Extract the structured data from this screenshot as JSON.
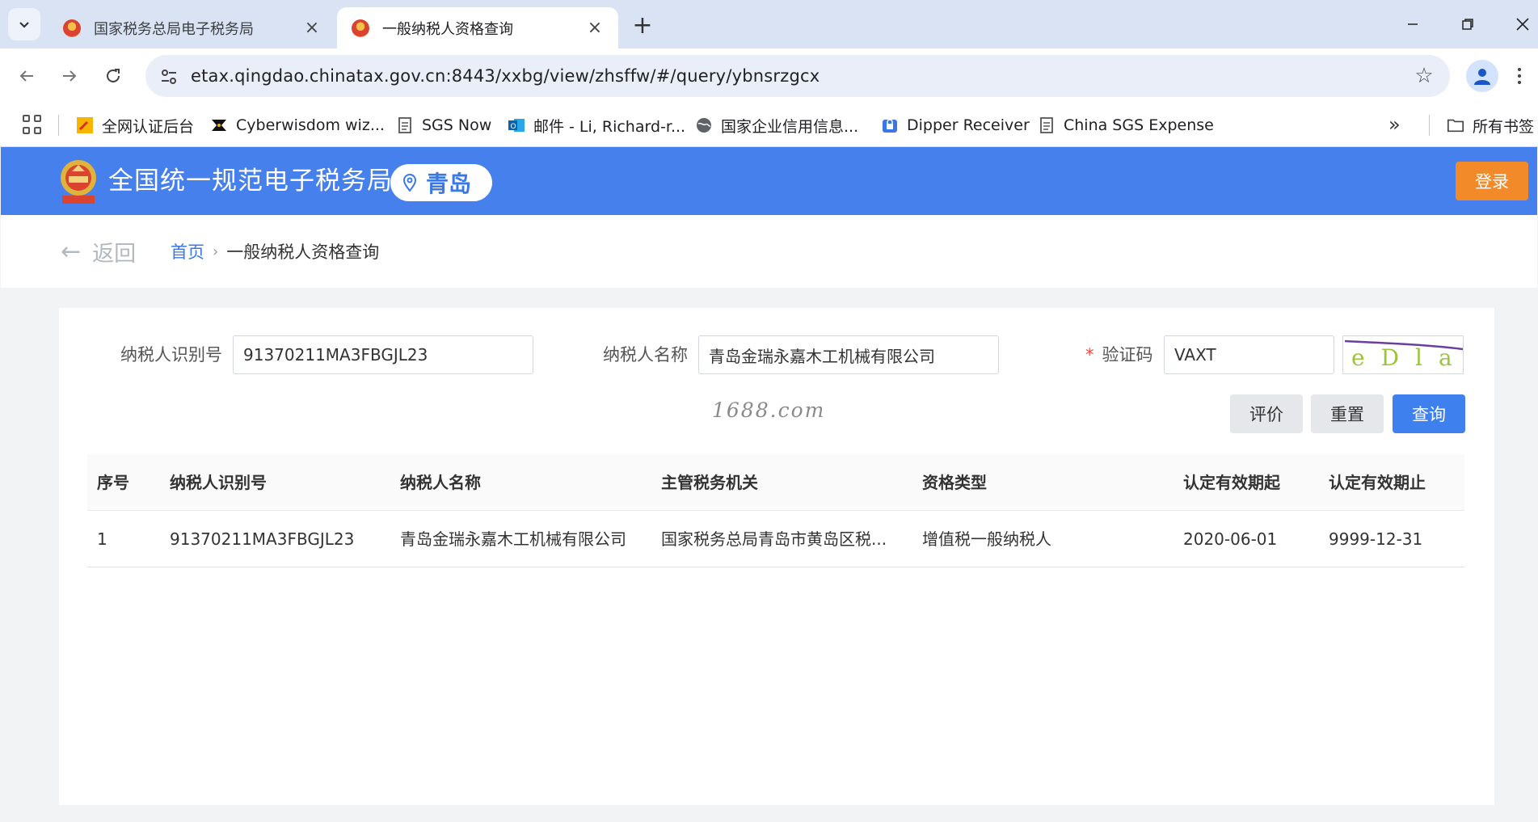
{
  "browser": {
    "tabs": [
      {
        "title": "国家税务总局电子税务局",
        "active": false
      },
      {
        "title": "一般纳税人资格查询",
        "active": true
      }
    ],
    "url": "etax.qingdao.chinatax.gov.cn:8443/xxbg/view/zhsffw/#/query/ybnsrzgcx",
    "bookmarks": [
      {
        "label": "全网认证后台",
        "icon": "yellow-wrench-icon"
      },
      {
        "label": "Cyberwisdom wiz...",
        "icon": "cyberwisdom-logo-icon"
      },
      {
        "label": "SGS Now",
        "icon": "document-icon"
      },
      {
        "label": "邮件 - Li, Richard-r...",
        "icon": "outlook-icon"
      },
      {
        "label": "国家企业信用信息...",
        "icon": "globe-icon"
      },
      {
        "label": "Dipper Receiver",
        "icon": "lock-icon"
      },
      {
        "label": "China SGS Expense",
        "icon": "document-icon"
      }
    ],
    "all_bookmarks_label": "所有书签"
  },
  "site": {
    "title": "全国统一规范电子税务局",
    "city": "青岛",
    "login_label": "登录",
    "header_color": "#4680ec"
  },
  "breadcrumb": {
    "back_label": "返回",
    "home_label": "首页",
    "current_label": "一般纳税人资格查询"
  },
  "form": {
    "taxpayer_id_label": "纳税人识别号",
    "taxpayer_id_value": "91370211MA3FBGJL23",
    "taxpayer_name_label": "纳税人名称",
    "taxpayer_name_value": "青岛金瑞永嘉木工机械有限公司",
    "required_mark": "*",
    "captcha_label": "验证码",
    "captcha_value": "VAXT",
    "captcha_image_text": "eDla"
  },
  "actions": {
    "rate_label": "评价",
    "reset_label": "重置",
    "query_label": "查询"
  },
  "watermark": "1688.com",
  "table": {
    "headers": [
      "序号",
      "纳税人识别号",
      "纳税人名称",
      "主管税务机关",
      "资格类型",
      "认定有效期起",
      "认定有效期止"
    ],
    "rows": [
      [
        "1",
        "91370211MA3FBGJL23",
        "青岛金瑞永嘉木工机械有限公司",
        "国家税务总局青岛市黄岛区税...",
        "增值税一般纳税人",
        "2020-06-01",
        "9999-12-31"
      ]
    ]
  }
}
